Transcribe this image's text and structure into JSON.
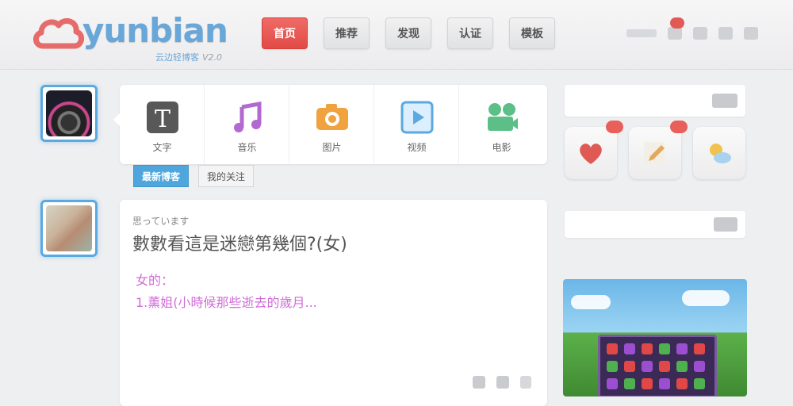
{
  "brand": {
    "name": "yunbian",
    "subtitle": "云边轻博客",
    "version": "V2.0",
    "color": "#6aa7d9",
    "accent_color": "#e25a55"
  },
  "nav": {
    "items": [
      {
        "label": "首页",
        "active": true
      },
      {
        "label": "推荐",
        "active": false
      },
      {
        "label": "发现",
        "active": false
      },
      {
        "label": "认证",
        "active": false
      },
      {
        "label": "模板",
        "active": false
      }
    ]
  },
  "header_tools": {
    "notification_icon": "bell-icon",
    "message_icon": "mail-icon",
    "settings_icon": "gear-icon",
    "profile_icon": "user-icon"
  },
  "publish": {
    "items": [
      {
        "label": "文字",
        "icon": "text-icon",
        "color": "#555555"
      },
      {
        "label": "音乐",
        "icon": "music-icon",
        "color": "#b16ad0"
      },
      {
        "label": "图片",
        "icon": "camera-icon",
        "color": "#f0a23e"
      },
      {
        "label": "视频",
        "icon": "video-icon",
        "color": "#5aa9e0"
      },
      {
        "label": "电影",
        "icon": "film-icon",
        "color": "#5cbf88"
      }
    ]
  },
  "tabs": {
    "items": [
      {
        "label": "最新博客",
        "active": true
      },
      {
        "label": "我的关注",
        "active": false
      }
    ]
  },
  "post": {
    "author": "思っています",
    "title": "數數看這是迷戀第幾個?(女)",
    "body_line1": "女的：",
    "body_line2": "1.薰姐(小時候那些逝去的歲月..."
  },
  "sidebar": {
    "icons": [
      {
        "icon": "heart-icon",
        "color": "#e05a55"
      },
      {
        "icon": "pencil-icon",
        "color": "#e3a85a"
      },
      {
        "icon": "weather-icon",
        "color": "#7bb8e0"
      }
    ]
  }
}
